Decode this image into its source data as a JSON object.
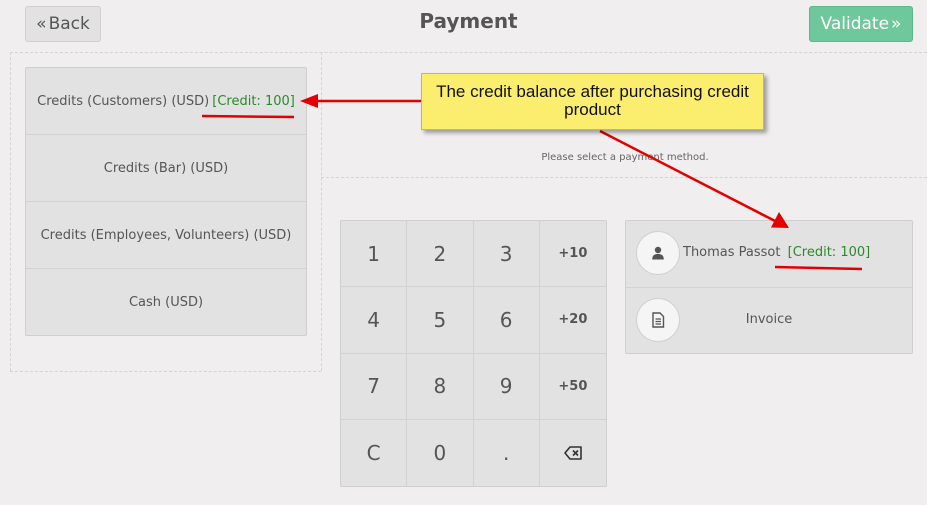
{
  "header": {
    "back_label": "Back",
    "title": "Payment",
    "validate_label": "Validate"
  },
  "payment_methods": [
    {
      "label": "Credits (Customers) (USD)",
      "credit": "[Credit: 100]"
    },
    {
      "label": "Credits (Bar) (USD)"
    },
    {
      "label": "Credits (Employees, Volunteers) (USD)"
    },
    {
      "label": "Cash (USD)"
    }
  ],
  "hint": "Please select a payment method.",
  "numpad": [
    "1",
    "2",
    "3",
    "+10",
    "4",
    "5",
    "6",
    "+20",
    "7",
    "8",
    "9",
    "+50",
    "C",
    "0",
    "."
  ],
  "customer": {
    "name": "Thomas Passot",
    "credit": "[Credit: 100]",
    "invoice_label": "Invoice"
  },
  "annotation": {
    "text": "The credit balance after purchasing credit product"
  },
  "colors": {
    "credit_text": "#2a8a2a",
    "validate_bg": "#6ec89b",
    "annotation_bg": "#fbee6e",
    "annotation_arrow": "#e30000"
  },
  "icons": {
    "back": "double-chevron-left",
    "validate": "double-chevron-right",
    "customer": "user",
    "invoice": "document",
    "backspace": "backspace"
  }
}
